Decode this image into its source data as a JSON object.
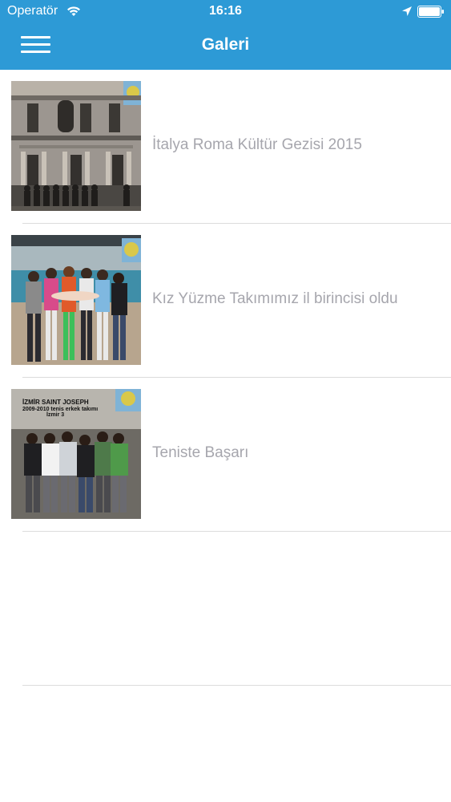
{
  "status_bar": {
    "carrier": "Operatör",
    "time": "16:16",
    "icons": [
      "wifi-icon",
      "location-icon",
      "battery-icon"
    ]
  },
  "nav": {
    "title": "Galeri",
    "menu_icon": "hamburger-menu-icon"
  },
  "gallery": {
    "items": [
      {
        "title": "İtalya Roma Kültür Gezisi 2015"
      },
      {
        "title": "Kız Yüzme Takımımız il birincisi oldu"
      },
      {
        "title": "Teniste Başarı",
        "image_caption_lines": [
          "İZMİR SAINT JOSEPH",
          "2009-2010 tenis erkek takımı",
          "İzmir 3"
        ]
      }
    ]
  },
  "colors": {
    "header": "#2d9ad6",
    "item_text": "#a6a6ad",
    "separator": "#dcdcdc"
  }
}
